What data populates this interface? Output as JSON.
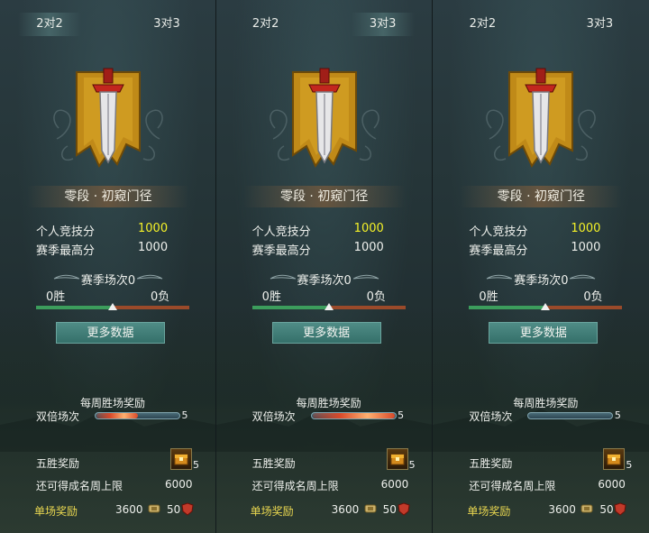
{
  "panels": [
    {
      "tabs": [
        "2对2",
        "3对3"
      ],
      "active_tab": 0,
      "rank": "零段 · 初窥门径",
      "stats": {
        "personal_label": "个人竞技分",
        "personal_value": "1000",
        "season_high_label": "赛季最高分",
        "season_high_value": "1000"
      },
      "season_count": "赛季场次0",
      "wins": "0胜",
      "losses": "0负",
      "more_button": "更多数据",
      "weekly_title": "每周胜场奖励",
      "double_label": "双倍场次",
      "double_count": "5",
      "double_fill": 0.5,
      "five_win_label": "五胜奖励",
      "chest_count": "5",
      "remain_label": "还可得成名周上限",
      "remain_value": "6000",
      "single_label": "单场奖励",
      "single_coin": "3600",
      "single_shield": "50"
    },
    {
      "tabs": [
        "2对2",
        "3对3"
      ],
      "active_tab": 1,
      "rank": "零段 · 初窥门径",
      "stats": {
        "personal_label": "个人竞技分",
        "personal_value": "1000",
        "season_high_label": "赛季最高分",
        "season_high_value": "1000"
      },
      "season_count": "赛季场次0",
      "wins": "0胜",
      "losses": "0负",
      "more_button": "更多数据",
      "weekly_title": "每周胜场奖励",
      "double_label": "双倍场次",
      "double_count": "5",
      "double_fill": 1.0,
      "five_win_label": "五胜奖励",
      "chest_count": "5",
      "remain_label": "还可得成名周上限",
      "remain_value": "6000",
      "single_label": "单场奖励",
      "single_coin": "3600",
      "single_shield": "50"
    },
    {
      "tabs": [
        "2对2",
        "3对3"
      ],
      "active_tab": -1,
      "rank": "零段 · 初窥门径",
      "stats": {
        "personal_label": "个人竞技分",
        "personal_value": "1000",
        "season_high_label": "赛季最高分",
        "season_high_value": "1000"
      },
      "season_count": "赛季场次0",
      "wins": "0胜",
      "losses": "0负",
      "more_button": "更多数据",
      "weekly_title": "每周胜场奖励",
      "double_label": "双倍场次",
      "double_count": "5",
      "double_fill": 0.0,
      "five_win_label": "五胜奖励",
      "chest_count": "5",
      "remain_label": "还可得成名周上限",
      "remain_value": "6000",
      "single_label": "单场奖励",
      "single_coin": "3600",
      "single_shield": "50"
    }
  ],
  "colors": {
    "highlight_score": "#f4f128",
    "single_reward_label": "#e8d650",
    "win_bar": "#3c9d5c",
    "loss_bar": "#9a4a2a",
    "button": "#3f7e78"
  }
}
